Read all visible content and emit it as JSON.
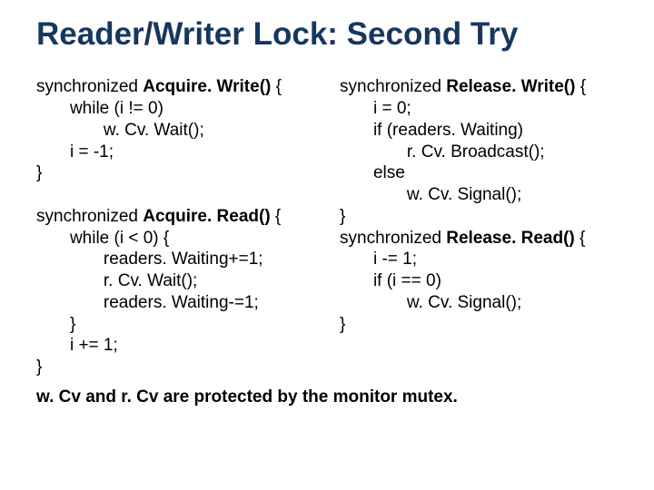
{
  "title": "Reader/Writer Lock: Second Try",
  "left": {
    "aw0": "synchronized ",
    "aw0b": "Acquire. Write()",
    "aw0c": " {",
    "aw1": "       while (i != 0)",
    "aw2": "              w. Cv. Wait();",
    "aw3": "       i = -1;",
    "aw4": "}",
    "ar0": "synchronized ",
    "ar0b": "Acquire. Read()",
    "ar0c": " {",
    "ar1": "       while (i < 0) {",
    "ar2": "              readers. Waiting+=1;",
    "ar3": "              r. Cv. Wait();",
    "ar4": "              readers. Waiting-=1;",
    "ar5": "       }",
    "ar6": "       i += 1;",
    "ar7": "}"
  },
  "right": {
    "rw0": "synchronized ",
    "rw0b": "Release. Write()",
    "rw0c": " {",
    "rw1": "       i = 0;",
    "rw2": "       if (readers. Waiting)",
    "rw3": "              r. Cv. Broadcast();",
    "rw4": "       else",
    "rw5": "              w. Cv. Signal();",
    "rw6": "}",
    "rr0": "synchronized ",
    "rr0b": "Release. Read()",
    "rr0c": " {",
    "rr1": "       i -= 1;",
    "rr2": "       if (i == 0)",
    "rr3": "              w. Cv. Signal();",
    "rr4": "}"
  },
  "footer": " w. Cv and r. Cv are protected by the monitor mutex."
}
